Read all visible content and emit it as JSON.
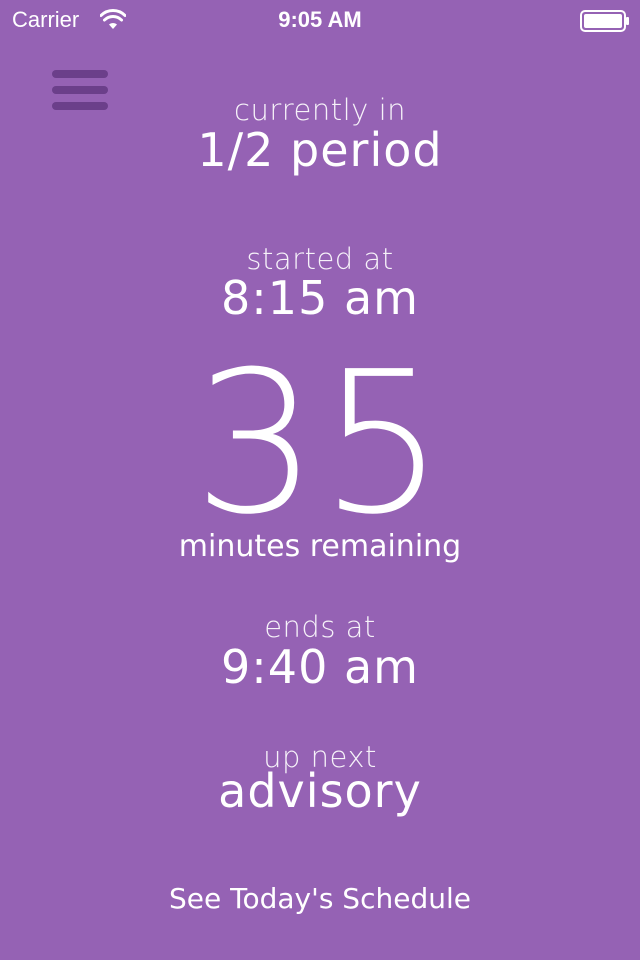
{
  "theme": {
    "background": "#9562b4",
    "menu_bar_color": "#6b3f8a"
  },
  "status_bar": {
    "carrier": "Carrier",
    "time": "9:05 AM",
    "wifi_icon": "wifi-icon",
    "battery_icon": "battery-icon"
  },
  "menu": {
    "icon": "hamburger-menu-icon"
  },
  "current": {
    "label": "currently in",
    "value": "1/2 period"
  },
  "start": {
    "label": "started at",
    "value": "8:15 am"
  },
  "remaining": {
    "value": "35",
    "label": "minutes remaining"
  },
  "end": {
    "label": "ends at",
    "value": "9:40 am"
  },
  "next": {
    "label": "up next",
    "value": "advisory"
  },
  "footer": {
    "schedule_button": "See Today's Schedule"
  }
}
